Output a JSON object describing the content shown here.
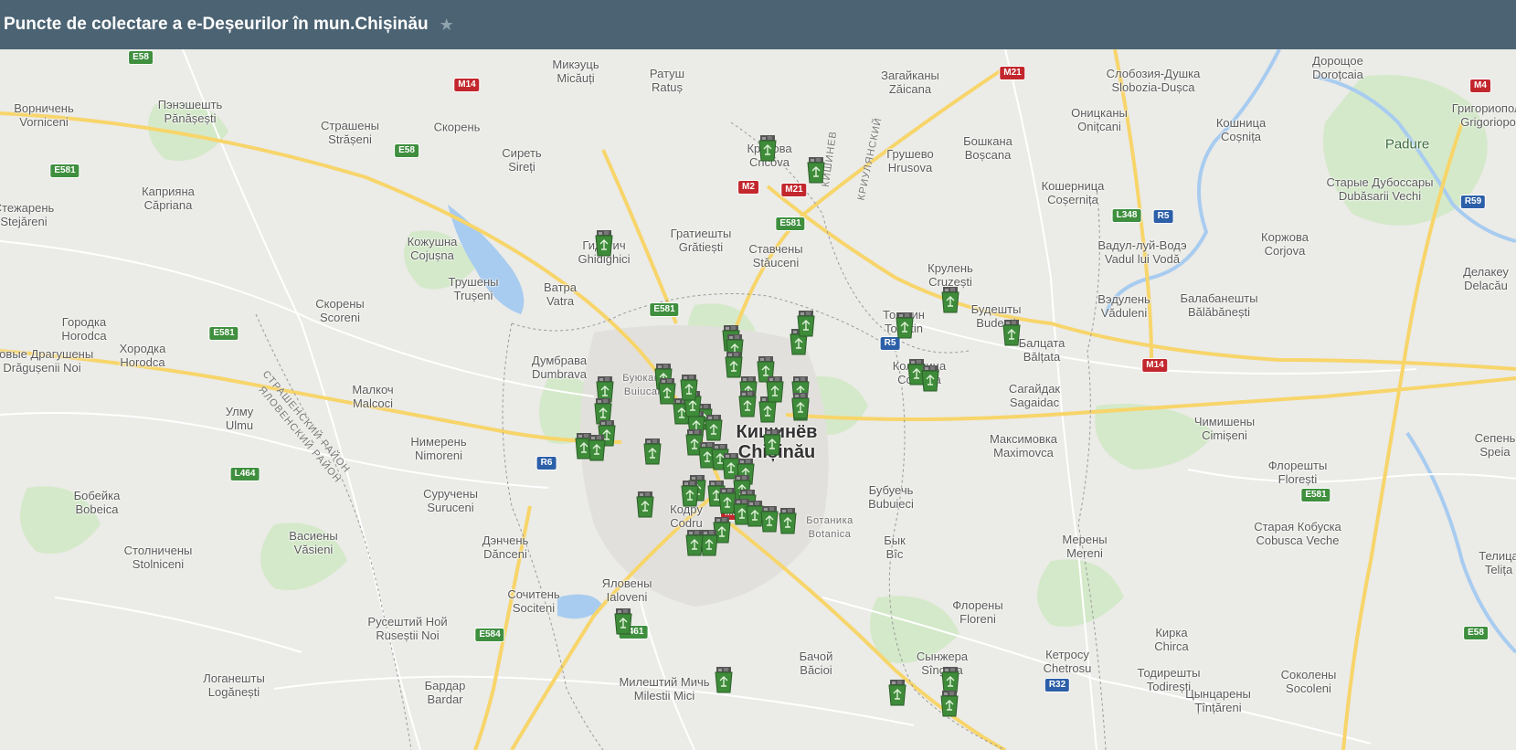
{
  "header": {
    "title": "Puncte de colectare a e-Deșeurilor în mun.Chișinău",
    "star": "★"
  },
  "colors": {
    "header_bg": "#4b6373",
    "water": "#a8ccf0",
    "park": "#cfe8c6",
    "road_major": "#f7d56a",
    "marker_green": "#3e8b3a"
  },
  "places": [
    {
      "name": "Mикэуць",
      "sub": "Micăuți",
      "cls": ""
    },
    {
      "name": "Ратуш",
      "sub": "Ratuș",
      "cls": ""
    },
    {
      "name": "Загайканы",
      "sub": "Zăicana",
      "cls": ""
    },
    {
      "name": "Слобозия-Душка",
      "sub": "Slobozia-Dușca",
      "cls": ""
    },
    {
      "name": "Дорощое",
      "sub": "Doroțcaia",
      "cls": ""
    },
    {
      "name": "Ворничень",
      "sub": "Vorniceni",
      "cls": ""
    },
    {
      "name": "Пэнэшешть",
      "sub": "Pănășești",
      "cls": ""
    },
    {
      "name": "Страшены",
      "sub": "Strășeni",
      "cls": ""
    },
    {
      "name": "Скорень",
      "sub": "",
      "cls": ""
    },
    {
      "name": "Сиреть",
      "sub": "Sireți",
      "cls": ""
    },
    {
      "name": "Крикова",
      "sub": "Cricova",
      "cls": ""
    },
    {
      "name": "Грушево",
      "sub": "Hrusova",
      "cls": ""
    },
    {
      "name": "Бошкана",
      "sub": "Boșcana",
      "cls": ""
    },
    {
      "name": "Оницканы",
      "sub": "Onițcani",
      "cls": ""
    },
    {
      "name": "Кошница",
      "sub": "Coșnița",
      "cls": ""
    },
    {
      "name": "Padure",
      "sub": "",
      "cls": ""
    },
    {
      "name": "Старые Дубоссары",
      "sub": "Dubăsarii Vechi",
      "cls": ""
    },
    {
      "name": "Григориополь",
      "sub": "Grigoriopol",
      "cls": ""
    },
    {
      "name": "Кошерница",
      "sub": "Coșernița",
      "cls": ""
    },
    {
      "name": "Каприяна",
      "sub": "Căpriana",
      "cls": ""
    },
    {
      "name": "Стежарень",
      "sub": "Stejăreni",
      "cls": ""
    },
    {
      "name": "Кожушна",
      "sub": "Cojușna",
      "cls": ""
    },
    {
      "name": "Гидигич",
      "sub": "Ghidighici",
      "cls": ""
    },
    {
      "name": "Гратиешты",
      "sub": "Grătiești",
      "cls": ""
    },
    {
      "name": "Ставчены",
      "sub": "Stăuceni",
      "cls": ""
    },
    {
      "name": "Крулень",
      "sub": "Cruzești",
      "cls": ""
    },
    {
      "name": "Вадул-луй-Водэ",
      "sub": "Vadul lui Vodă",
      "cls": ""
    },
    {
      "name": "Коржова",
      "sub": "Corjova",
      "cls": ""
    },
    {
      "name": "Делакеу",
      "sub": "Delacău",
      "cls": ""
    },
    {
      "name": "Трушены",
      "sub": "Trușeni",
      "cls": ""
    },
    {
      "name": "Ватра",
      "sub": "Vatra",
      "cls": ""
    },
    {
      "name": "Скорены",
      "sub": "Scoreni",
      "cls": ""
    },
    {
      "name": "Тогатин",
      "sub": "Tohatin",
      "cls": ""
    },
    {
      "name": "Будешты",
      "sub": "Budești",
      "cls": ""
    },
    {
      "name": "Вэдулень",
      "sub": "Văduleni",
      "cls": ""
    },
    {
      "name": "Балабанешты",
      "sub": "Bălăbănești",
      "cls": ""
    },
    {
      "name": "Городка",
      "sub": "Horodca",
      "cls": ""
    },
    {
      "name": "Хородка",
      "sub": "Horodca",
      "cls": ""
    },
    {
      "name": "Новые Драгушены",
      "sub": "Drăgușenii Noi",
      "cls": ""
    },
    {
      "name": "Думбрава",
      "sub": "Dumbrava",
      "cls": ""
    },
    {
      "name": "Колоница",
      "sub": "Colonița",
      "cls": ""
    },
    {
      "name": "Балцата",
      "sub": "Bălțata",
      "cls": ""
    },
    {
      "name": "Сагайдак",
      "sub": "Sagaidac",
      "cls": ""
    },
    {
      "name": "Малкоч",
      "sub": "Malcoci",
      "cls": ""
    },
    {
      "name": "Улму",
      "sub": "Ulmu",
      "cls": ""
    },
    {
      "name": "Кишинёв",
      "sub": "Chișinău",
      "cls": "city"
    },
    {
      "name": "Нимерень",
      "sub": "Nimoreni",
      "cls": ""
    },
    {
      "name": "Максимовка",
      "sub": "Maximovca",
      "cls": ""
    },
    {
      "name": "Чимишены",
      "sub": "Cimișeni",
      "cls": ""
    },
    {
      "name": "Сепень",
      "sub": "Speia",
      "cls": ""
    },
    {
      "name": "Флорешты",
      "sub": "Florești",
      "cls": ""
    },
    {
      "name": "Бобейка",
      "sub": "Bobeica",
      "cls": ""
    },
    {
      "name": "Суручены",
      "sub": "Suruceni",
      "cls": ""
    },
    {
      "name": "Кодру",
      "sub": "Codru",
      "cls": ""
    },
    {
      "name": "Бубуечь",
      "sub": "Bubuieci",
      "cls": ""
    },
    {
      "name": "Старая Кобуска",
      "sub": "Cobusca Veche",
      "cls": ""
    },
    {
      "name": "Васиены",
      "sub": "Văsieni",
      "cls": ""
    },
    {
      "name": "Дэнчень",
      "sub": "Dănceni",
      "cls": ""
    },
    {
      "name": "Бык",
      "sub": "Bîc",
      "cls": ""
    },
    {
      "name": "Столничены",
      "sub": "Stolniceni",
      "cls": ""
    },
    {
      "name": "Мерены",
      "sub": "Mereni",
      "cls": ""
    },
    {
      "name": "Телица",
      "sub": "Telița",
      "cls": ""
    },
    {
      "name": "Яловены",
      "sub": "Ialoveni",
      "cls": ""
    },
    {
      "name": "Сочитень",
      "sub": "Sociteni",
      "cls": ""
    },
    {
      "name": "Флорены",
      "sub": "Floreni",
      "cls": ""
    },
    {
      "name": "Русештий Ной",
      "sub": "Ruseștii Noi",
      "cls": ""
    },
    {
      "name": "Кирка",
      "sub": "Chirca",
      "cls": ""
    },
    {
      "name": "Бачой",
      "sub": "Băcioi",
      "cls": ""
    },
    {
      "name": "Сынжера",
      "sub": "Sîngera",
      "cls": ""
    },
    {
      "name": "Кетросу",
      "sub": "Chetrosu",
      "cls": ""
    },
    {
      "name": "Тодирешты",
      "sub": "Todirești",
      "cls": ""
    },
    {
      "name": "Соколены",
      "sub": "Socoleni",
      "cls": ""
    },
    {
      "name": "Логанешты",
      "sub": "Logănești",
      "cls": ""
    },
    {
      "name": "Милештий Мичь",
      "sub": "Milestii Mici",
      "cls": ""
    },
    {
      "name": "Бардар",
      "sub": "Bardar",
      "cls": ""
    },
    {
      "name": "Цынцарены",
      "sub": "Țînțăreni",
      "cls": ""
    },
    {
      "name": "Ботаника",
      "sub": "Botanica",
      "cls": "district"
    },
    {
      "name": "Буюканы",
      "sub": "Buiucani",
      "cls": "district"
    }
  ],
  "shields": [
    {
      "label": "E58",
      "color": "green"
    },
    {
      "label": "M14",
      "color": "red"
    },
    {
      "label": "M21",
      "color": "red"
    },
    {
      "label": "M4",
      "color": "red"
    },
    {
      "label": "E58",
      "color": "green"
    },
    {
      "label": "E581",
      "color": "green"
    },
    {
      "label": "M2",
      "color": "red"
    },
    {
      "label": "M21",
      "color": "red"
    },
    {
      "label": "E581",
      "color": "green"
    },
    {
      "label": "L348",
      "color": "green"
    },
    {
      "label": "R5",
      "color": "blue"
    },
    {
      "label": "R59",
      "color": "blue"
    },
    {
      "label": "E581",
      "color": "green"
    },
    {
      "label": "E581",
      "color": "green"
    },
    {
      "label": "R5",
      "color": "blue"
    },
    {
      "label": "M14",
      "color": "red"
    },
    {
      "label": "R6",
      "color": "blue"
    },
    {
      "label": "L464",
      "color": "green"
    },
    {
      "label": "M3",
      "color": "red"
    },
    {
      "label": "E581",
      "color": "green"
    },
    {
      "label": "E584",
      "color": "green"
    },
    {
      "label": "L461",
      "color": "green"
    },
    {
      "label": "R32",
      "color": "blue"
    },
    {
      "label": "E58",
      "color": "green"
    }
  ],
  "regions": [
    {
      "label": "СТРАШЕНСКИЙ РАЙОН"
    },
    {
      "label": "ЯЛОВЕНСКИЙ РАЙОН"
    },
    {
      "label": "КРИУЛЯНСКИЙ"
    },
    {
      "label": "КИШИНЕВ"
    }
  ],
  "markers": [
    {
      "id": 1
    },
    {
      "id": 2
    },
    {
      "id": 3
    },
    {
      "id": 4
    },
    {
      "id": 5
    },
    {
      "id": 6
    },
    {
      "id": 7
    },
    {
      "id": 8
    },
    {
      "id": 9
    },
    {
      "id": 10
    },
    {
      "id": 11
    },
    {
      "id": 12
    },
    {
      "id": 13
    },
    {
      "id": 14
    },
    {
      "id": 15
    },
    {
      "id": 16
    },
    {
      "id": 17
    },
    {
      "id": 18
    },
    {
      "id": 19
    },
    {
      "id": 20
    },
    {
      "id": 21
    },
    {
      "id": 22
    },
    {
      "id": 23
    },
    {
      "id": 24
    },
    {
      "id": 25
    },
    {
      "id": 26
    },
    {
      "id": 27
    },
    {
      "id": 28
    },
    {
      "id": 29
    },
    {
      "id": 30
    },
    {
      "id": 31
    },
    {
      "id": 32
    },
    {
      "id": 33
    },
    {
      "id": 34
    },
    {
      "id": 35
    },
    {
      "id": 36
    },
    {
      "id": 37
    },
    {
      "id": 38
    },
    {
      "id": 39
    },
    {
      "id": 40
    },
    {
      "id": 41
    },
    {
      "id": 42
    },
    {
      "id": 43
    },
    {
      "id": 44
    },
    {
      "id": 45
    },
    {
      "id": 46
    },
    {
      "id": 47
    },
    {
      "id": 48
    },
    {
      "id": 49
    },
    {
      "id": 50
    },
    {
      "id": 51
    },
    {
      "id": 52
    },
    {
      "id": 53
    },
    {
      "id": 54
    },
    {
      "id": 55
    },
    {
      "id": 56
    },
    {
      "id": 57
    },
    {
      "id": 58
    },
    {
      "id": 59
    },
    {
      "id": 60
    }
  ]
}
